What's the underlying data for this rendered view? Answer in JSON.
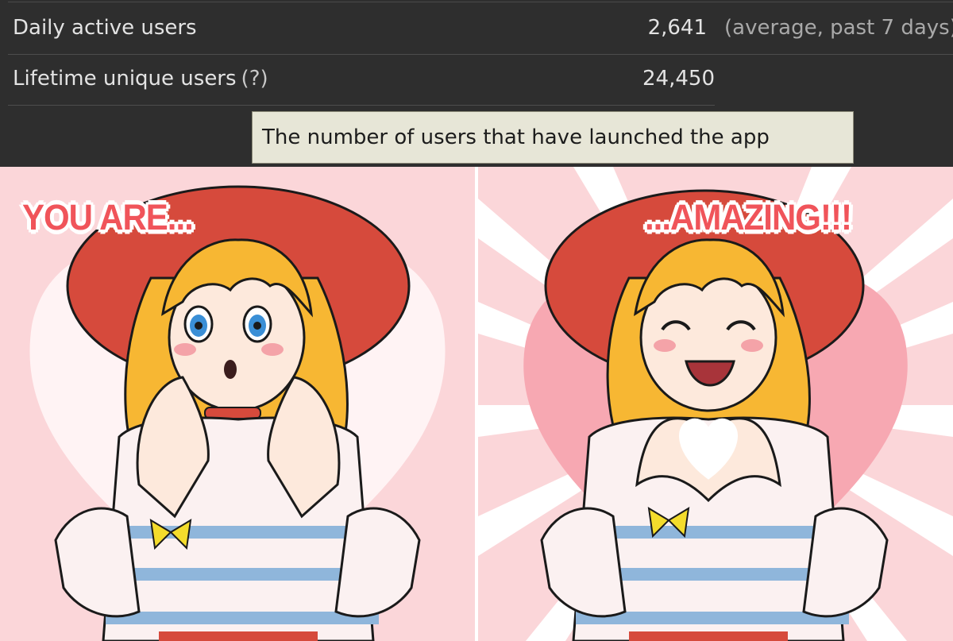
{
  "stats": {
    "daily_active": {
      "label": "Daily active users",
      "value": "2,641",
      "note": "(average, past 7 days)"
    },
    "lifetime_unique": {
      "label": "Lifetime unique users",
      "help": "(?)",
      "value": "24,450"
    },
    "tooltip": "The number of users that have launched the app"
  },
  "comic": {
    "left_caption": "YOU ARE...",
    "right_caption": "...AMAZING!!!"
  },
  "colors": {
    "panel_bg": "#2e2e2e",
    "text": "#e3e3e3",
    "tooltip_bg": "#e7e6d7",
    "caption": "#f0545a",
    "hat": "#d64a3c",
    "hair": "#f7b733",
    "pink_bg": "#fbd6d9"
  }
}
